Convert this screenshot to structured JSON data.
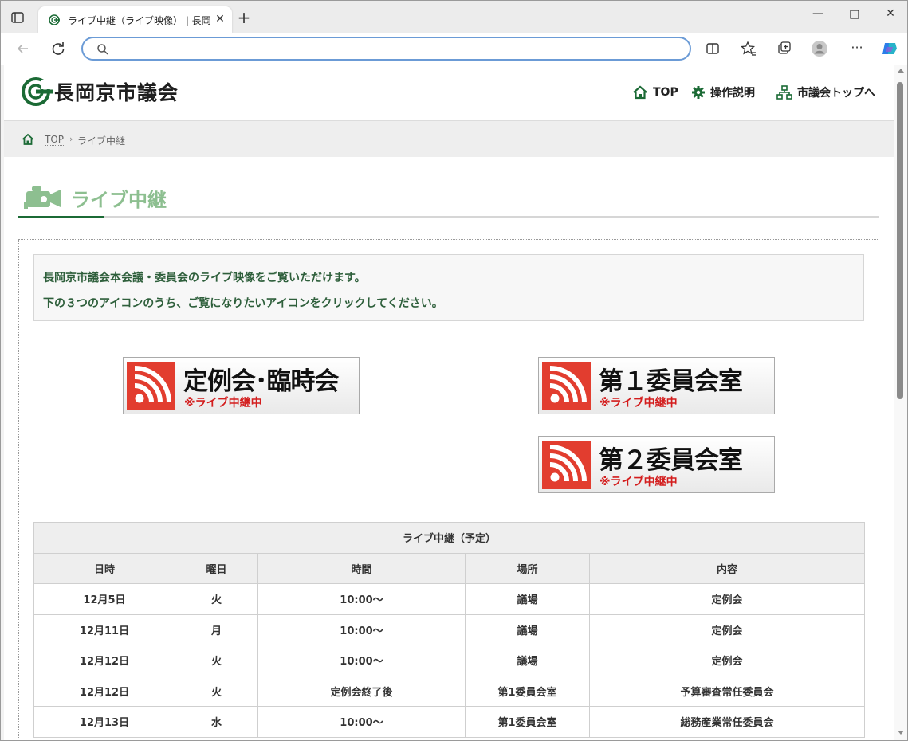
{
  "browser": {
    "tab_title": "ライブ中継（ライブ映像） | 長岡京市",
    "address_text": ""
  },
  "site": {
    "logo_text": "長岡京市議会",
    "nav": [
      {
        "label": "TOP",
        "icon": "home-icon"
      },
      {
        "label": "操作説明",
        "icon": "gear-icon"
      },
      {
        "label": "市議会トップへ",
        "icon": "sitemap-icon"
      }
    ],
    "accent_color": "#1b6a35"
  },
  "breadcrumb": {
    "top": "TOP",
    "separator": "›",
    "current": "ライブ中継"
  },
  "page": {
    "title": "ライブ中継",
    "notice_line1": "長岡京市議会本会議・委員会のライブ映像をご覧いただけます。",
    "notice_line2": "下の３つのアイコンのうち、ご覧になりたいアイコンをクリックしてください。"
  },
  "live_buttons": [
    {
      "label": "定例会･臨時会",
      "sub": "※ライブ中継中"
    },
    {
      "label": "第１委員会室",
      "sub": "※ライブ中継中"
    },
    {
      "label": "第２委員会室",
      "sub": "※ライブ中継中"
    }
  ],
  "schedule": {
    "caption": "ライブ中継（予定）",
    "headers": [
      "日時",
      "曜日",
      "時間",
      "場所",
      "内容"
    ],
    "rows": [
      [
        "12月5日",
        "火",
        "10:00〜",
        "議場",
        "定例会"
      ],
      [
        "12月11日",
        "月",
        "10:00〜",
        "議場",
        "定例会"
      ],
      [
        "12月12日",
        "火",
        "10:00〜",
        "議場",
        "定例会"
      ],
      [
        "12月12日",
        "火",
        "定例会終了後",
        "第1委員会室",
        "予算審査常任委員会"
      ],
      [
        "12月13日",
        "水",
        "10:00〜",
        "第1委員会室",
        "総務産業常任委員会"
      ]
    ]
  }
}
